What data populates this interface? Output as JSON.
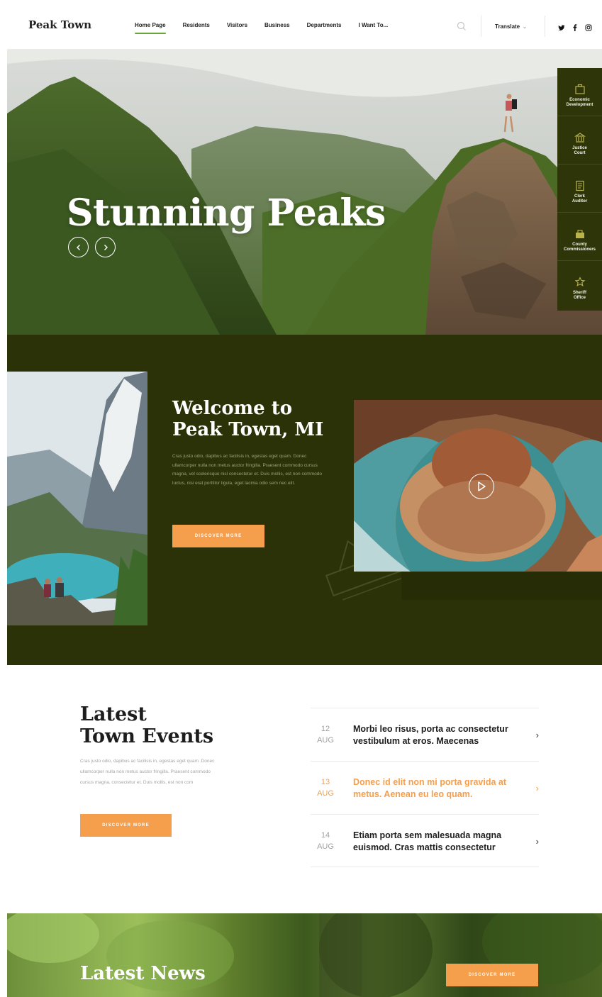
{
  "header": {
    "logo": "Peak Town",
    "nav": [
      "Home Page",
      "Residents",
      "Visitors",
      "Business",
      "Departments",
      "I Want To..."
    ],
    "translate": "Translate",
    "social_icons": [
      "twitter-icon",
      "facebook-icon",
      "instagram-icon"
    ]
  },
  "hero": {
    "title": "Stunning Peaks",
    "prev_icon": "chevron-left-icon",
    "next_icon": "chevron-right-icon"
  },
  "side_panel": {
    "items": [
      {
        "label_1": "Economic",
        "label_2": "Development",
        "icon": "briefcase-icon"
      },
      {
        "label_1": "Justice",
        "label_2": "Court",
        "icon": "courthouse-icon"
      },
      {
        "label_1": "Clerk",
        "label_2": "Auditor",
        "icon": "document-icon"
      },
      {
        "label_1": "County",
        "label_2": "Commissioners",
        "icon": "building-icon"
      },
      {
        "label_1": "Sheriff",
        "label_2": "Office",
        "icon": "badge-icon"
      }
    ]
  },
  "welcome": {
    "title_line1": "Welcome to",
    "title_line2": "Peak Town, MI",
    "body": "Cras justo odio, dapibus ac facilisis in, egestas eget quam. Donec ullamcorper nulla non metus auctor fringilla. Praesent commodo cursus magna, vel scelerisque nisl consectetur et. Duis mollis, est non commodo luctus, nisi erat porttitor ligula, eget lacinia odio sem nec elit.",
    "button": "DISCOVER MORE"
  },
  "events": {
    "title_line1": "Latest",
    "title_line2": "Town Events",
    "body": "Cras justo odio, dapibus ac facilisis in, egestas eget quam. Donec ullamcorper nulla non metus auctor fringilla. Praesent commodo cursus magna, consectetur et. Duis mollis, est non com",
    "button": "DISCOVER MORE",
    "items": [
      {
        "day": "12",
        "month": "AUG",
        "text": "Morbi leo risus, porta ac consectetur vestibulum at eros. Maecenas"
      },
      {
        "day": "13",
        "month": "AUG",
        "text": "Donec id elit non mi porta gravida at metus. Aenean eu leo quam."
      },
      {
        "day": "14",
        "month": "AUG",
        "text": "Etiam porta sem malesuada magna euismod. Cras mattis consectetur"
      }
    ]
  },
  "news": {
    "title": "Latest News",
    "button": "DISCOVER MORE"
  },
  "colors": {
    "accent": "#f59e4c",
    "dark_olive": "#2c3208",
    "nav_underline": "#6aa53a"
  }
}
